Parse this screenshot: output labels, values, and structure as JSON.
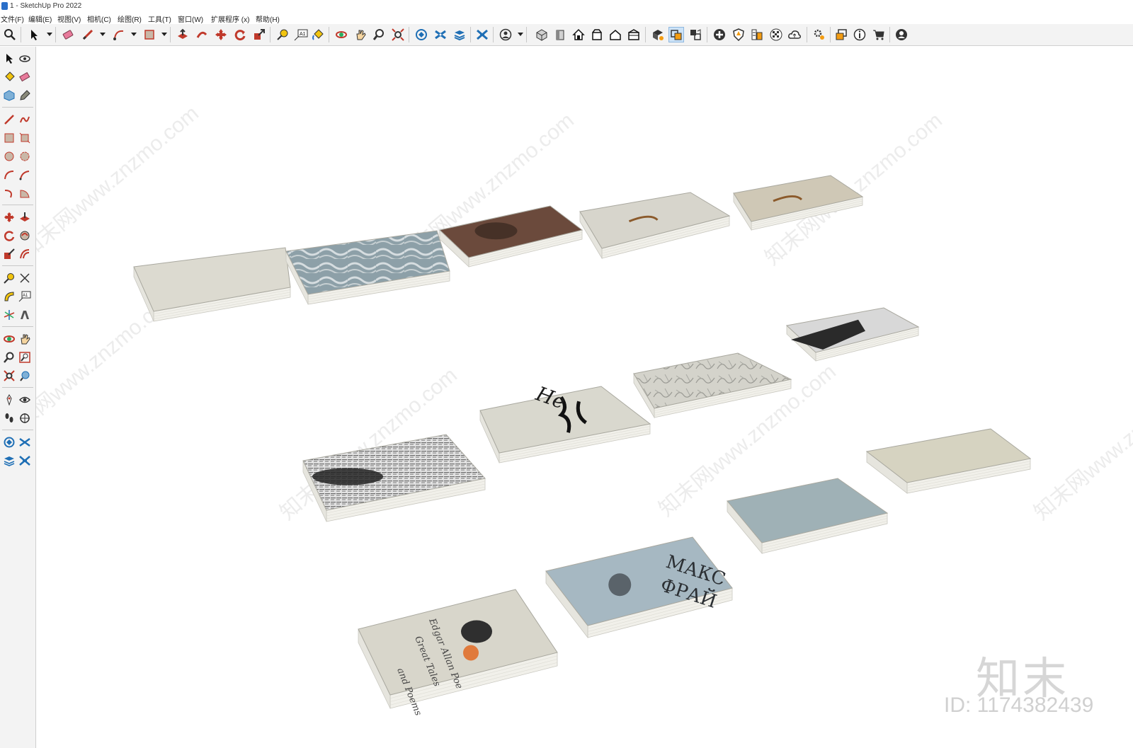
{
  "window": {
    "title": "1 - SketchUp Pro 2022"
  },
  "menu": [
    "文件(F)",
    "编辑(E)",
    "视图(V)",
    "相机(C)",
    "绘图(R)",
    "工具(T)",
    "窗口(W)",
    "扩展程序 (x)",
    "帮助(H)"
  ],
  "toolbar": {
    "tools": [
      {
        "name": "zoom-icon"
      },
      {
        "name": "select-icon"
      },
      {
        "name": "eraser-icon"
      },
      {
        "name": "line-icon"
      },
      {
        "name": "arc-icon"
      },
      {
        "name": "rectangle-icon"
      },
      {
        "name": "push-pull-icon"
      },
      {
        "name": "follow-me-icon"
      },
      {
        "name": "move-icon"
      },
      {
        "name": "rotate-icon"
      },
      {
        "name": "scale-icon"
      },
      {
        "name": "tape-measure-icon"
      },
      {
        "name": "text-icon"
      },
      {
        "name": "paint-bucket-icon"
      },
      {
        "name": "orbit-icon"
      },
      {
        "name": "pan-icon"
      },
      {
        "name": "zoom-tool-icon"
      },
      {
        "name": "zoom-extents-icon"
      },
      {
        "name": "warehouse-icon"
      },
      {
        "name": "sandbox-icon"
      },
      {
        "name": "layers-icon"
      },
      {
        "name": "section-icon"
      },
      {
        "name": "user-icon"
      },
      {
        "name": "iso-view-icon"
      },
      {
        "name": "front-view-icon"
      },
      {
        "name": "home-icon"
      },
      {
        "name": "top-view-icon"
      },
      {
        "name": "house-icon"
      },
      {
        "name": "back-view-icon"
      },
      {
        "name": "component-icon"
      },
      {
        "name": "solid-icon"
      },
      {
        "name": "scene-icon"
      },
      {
        "name": "add-location-icon"
      },
      {
        "name": "shield-icon"
      },
      {
        "name": "style-icon"
      },
      {
        "name": "checker-icon"
      },
      {
        "name": "cloud-icon"
      },
      {
        "name": "settings-icon"
      },
      {
        "name": "window-icon"
      },
      {
        "name": "info-icon"
      },
      {
        "name": "cart-icon"
      },
      {
        "name": "account-icon"
      }
    ],
    "text_tool_label": "A1"
  },
  "left_toolbar": {
    "text_label": "A1"
  },
  "scene": {
    "books": [
      {
        "label": "book-plain-cream-1",
        "cover": "#dcdad0",
        "pattern": "plain"
      },
      {
        "label": "book-marble-blue",
        "cover": "#8fa3ab",
        "pattern": "marble"
      },
      {
        "label": "book-brown-photo",
        "cover": "#6b4a3c",
        "pattern": "photo"
      },
      {
        "label": "book-grey-ink",
        "cover": "#d7d5cc",
        "pattern": "ink"
      },
      {
        "label": "book-beige-ink",
        "cover": "#cfc8b6",
        "pattern": "ink"
      },
      {
        "label": "book-bw-photo",
        "cover": "#d8d8d8",
        "pattern": "bw"
      },
      {
        "label": "book-sketch",
        "cover": "#d2d0c8",
        "pattern": "sketch"
      },
      {
        "label": "book-calligraphy",
        "cover": "#d9d8ce",
        "pattern": "calligraphy"
      },
      {
        "label": "book-newspaper",
        "cover": "#dcdcdc",
        "pattern": "newspaper"
      },
      {
        "label": "book-plain-cream-2",
        "cover": "#d6d3c1",
        "pattern": "plain"
      },
      {
        "label": "book-plain-blue",
        "cover": "#9fb1b6",
        "pattern": "plain"
      },
      {
        "label": "book-maks-frai",
        "cover": "#a6b8c2",
        "pattern": "cyrillic"
      },
      {
        "label": "book-poe",
        "cover": "#d8d6cb",
        "pattern": "poe"
      }
    ],
    "cover_text": {
      "maks": "МАКС",
      "frai": "ФРАЙ",
      "ne_pr": "Не",
      "poe_line1": "Edgar Allan Poe",
      "poe_line2": "Great Tales",
      "poe_line3": "and Poems"
    }
  },
  "watermark": {
    "logo": "知末",
    "id_text": "ID: 1174382439",
    "diag_text": "知末网www.znzmo.com"
  }
}
